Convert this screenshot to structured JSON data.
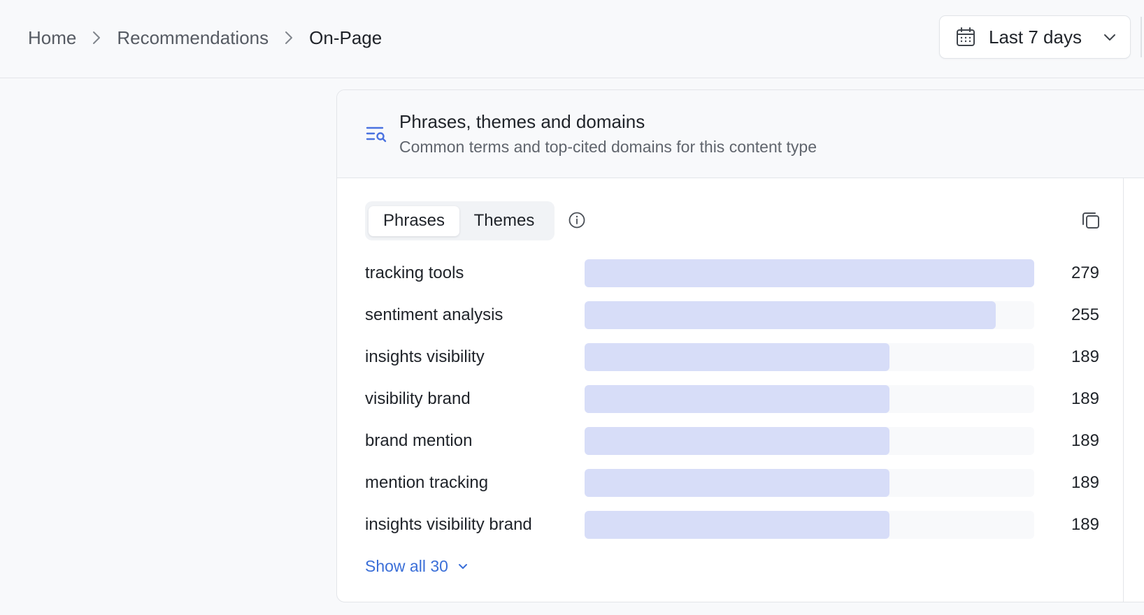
{
  "breadcrumb": {
    "home": "Home",
    "recommendations": "Recommendations",
    "current": "On-Page"
  },
  "date_filter": {
    "label": "Last 7 days",
    "icon": "calendar-icon"
  },
  "card": {
    "icon": "list-search-icon",
    "title": "Phrases, themes and domains",
    "subtitle": "Common terms and top-cited domains for this content type",
    "tabs": [
      {
        "label": "Phrases",
        "active": true
      },
      {
        "label": "Themes",
        "active": false
      }
    ],
    "info_icon": "info-icon",
    "copy_icon": "copy-icon",
    "show_all": "Show all 30"
  },
  "colors": {
    "bar_fill": "#d7ddf8",
    "bar_track": "#f8f9fb",
    "accent": "#3b6fd8",
    "icon_blue": "#4a72e0"
  },
  "chart_data": {
    "type": "bar",
    "orientation": "horizontal",
    "categories": [
      "tracking tools",
      "sentiment analysis",
      "insights visibility",
      "visibility brand",
      "brand mention",
      "mention tracking",
      "insights visibility brand"
    ],
    "values": [
      279,
      255,
      189,
      189,
      189,
      189,
      189
    ],
    "max": 279
  }
}
